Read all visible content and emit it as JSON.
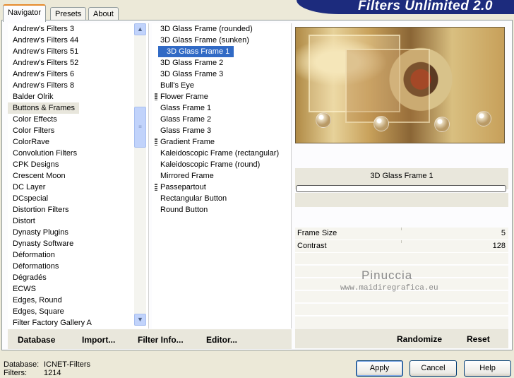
{
  "tabs": [
    "Navigator",
    "Presets",
    "About"
  ],
  "banner": "Filters Unlimited 2.0",
  "categories": [
    "Andrew's Filters 3",
    "Andrew's Filters 44",
    "Andrew's Filters 51",
    "Andrew's Filters 52",
    "Andrew's Filters 6",
    "Andrew's Filters 8",
    "Balder Olrik",
    "Buttons & Frames",
    "Color Effects",
    "Color Filters",
    "ColorRave",
    "Convolution Filters",
    "CPK Designs",
    "Crescent Moon",
    "DC Layer",
    "DCspecial",
    "Distortion Filters",
    "Distort",
    "Dynasty Plugins",
    "Dynasty Software",
    "Déformation",
    "Déformations",
    "Dégradés",
    "ECWS",
    "Edges, Round",
    "Edges, Square",
    "Filter Factory Gallery A"
  ],
  "filters": [
    "3D Glass Frame (rounded)",
    "3D Glass Frame (sunken)",
    "3D Glass Frame 1",
    "3D Glass Frame 2",
    "3D Glass Frame 3",
    "Bull's Eye",
    "Flower Frame",
    "Glass Frame 1",
    "Glass Frame 2",
    "Glass Frame 3",
    "Gradient Frame",
    "Kaleidoscopic Frame (rectangular)",
    "Kaleidoscopic Frame (round)",
    "Mirrored Frame",
    "Passepartout",
    "Rectangular Button",
    "Round Button"
  ],
  "bottom_buttons": {
    "database": "Database",
    "import": "Import...",
    "filter_info": "Filter Info...",
    "editor": "Editor...",
    "randomize": "Randomize",
    "reset": "Reset"
  },
  "preview": {
    "title": "3D Glass Frame 1",
    "params": [
      {
        "label": "Frame Size",
        "value": "5"
      },
      {
        "label": "Contrast",
        "value": "128"
      }
    ]
  },
  "watermark": {
    "name": "Pinuccia",
    "url": "www.maidiregrafica.eu"
  },
  "status": {
    "database_label": "Database:",
    "database_value": "ICNET-Filters",
    "filters_label": "Filters:",
    "filters_value": "1214"
  },
  "dialog_buttons": {
    "apply": "Apply",
    "cancel": "Cancel",
    "help": "Help"
  }
}
